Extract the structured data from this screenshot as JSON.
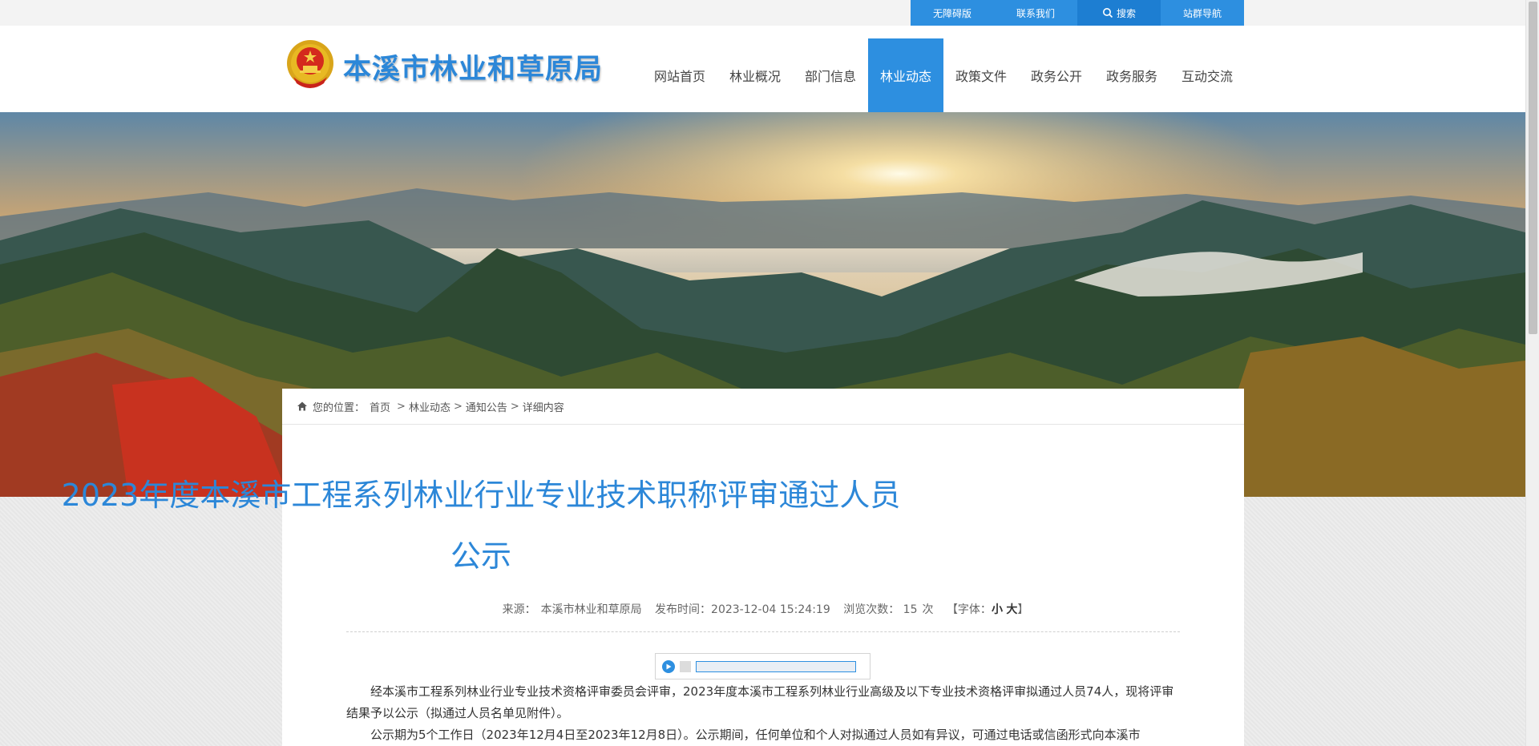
{
  "toplinks": {
    "accessible": "无障碍版",
    "contact": "联系我们",
    "search": "搜索",
    "sitemap": "站群导航"
  },
  "header": {
    "title": "本溪市林业和草原局"
  },
  "nav": [
    {
      "label": "网站首页"
    },
    {
      "label": "林业概况"
    },
    {
      "label": "部门信息"
    },
    {
      "label": "林业动态",
      "active": true
    },
    {
      "label": "政策文件"
    },
    {
      "label": "政务公开"
    },
    {
      "label": "政务服务"
    },
    {
      "label": "互动交流"
    }
  ],
  "breadcrumb": {
    "prefix": "您的位置：",
    "home": "首页",
    "sep": ">",
    "level1": "林业动态",
    "level2": "通知公告",
    "level3": "详细内容"
  },
  "article": {
    "title": "2023年度本溪市工程系列林业行业专业技术职称评审通过人员公示",
    "source_label": "来源：",
    "source": "本溪市林业和草原局",
    "time_label": "发布时间：",
    "time": "2023-12-04 15:24:19",
    "views_label": "浏览次数：",
    "views": "15",
    "views_unit": "次",
    "font_open": "【字体：",
    "font_small": "小",
    "font_large": "大",
    "font_close": "】",
    "paragraphs": [
      "经本溪市工程系列林业行业专业技术资格评审委员会评审，2023年度本溪市工程系列林业行业高级及以下专业技术资格评审拟通过人员74人，现将评审结果予以公示（拟通过人员名单见附件）。",
      "公示期为5个工作日（2023年12月4日至2023年12月8日）。公示期间，任何单位和个人对拟通过人员如有异议，可通过电话或信函形式向本溪市"
    ]
  },
  "colors": {
    "accent": "#2d8fe0",
    "title": "#2c87d8"
  }
}
